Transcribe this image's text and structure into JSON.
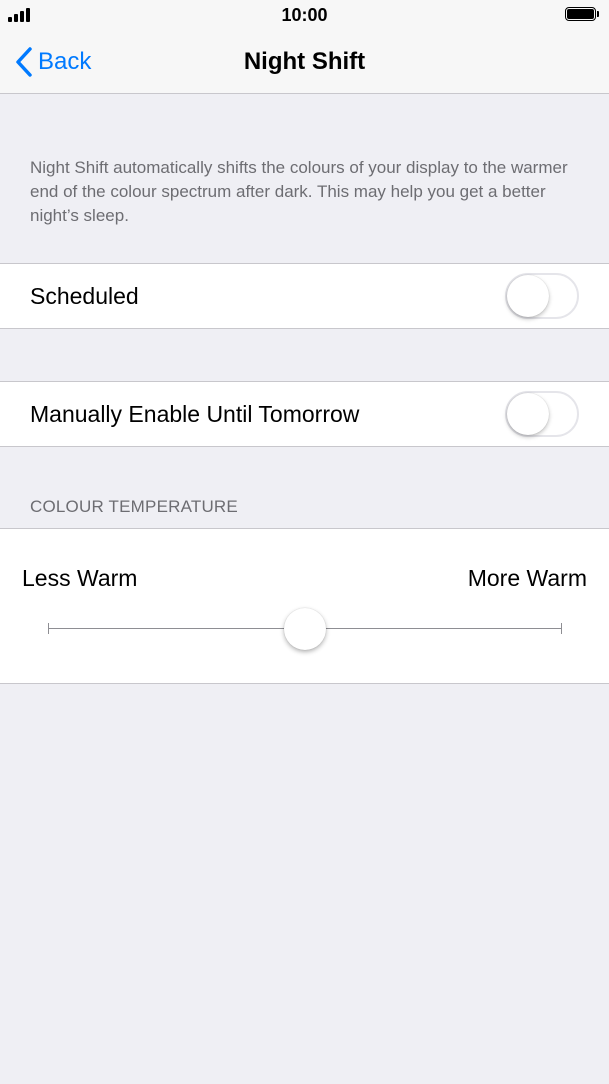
{
  "status_bar": {
    "time": "10:00",
    "signal_icon": "cellular-signal-icon",
    "battery_icon": "battery-full-icon"
  },
  "nav": {
    "back_label": "Back",
    "back_icon": "chevron-left-icon",
    "title": "Night Shift"
  },
  "description": "Night Shift automatically shifts the colours of your display to the warmer end of the colour spectrum after dark. This may help you get a better night’s sleep.",
  "settings": {
    "scheduled": {
      "label": "Scheduled",
      "enabled": false
    },
    "manual": {
      "label": "Manually Enable Until Tomorrow",
      "enabled": false
    }
  },
  "colour_temperature": {
    "header": "COLOUR TEMPERATURE",
    "min_label": "Less Warm",
    "max_label": "More Warm",
    "value": 0.5
  },
  "colors": {
    "accent": "#007aff",
    "background": "#efeff4",
    "secondary_text": "#6d6d72",
    "separator": "#c8c7cc"
  }
}
